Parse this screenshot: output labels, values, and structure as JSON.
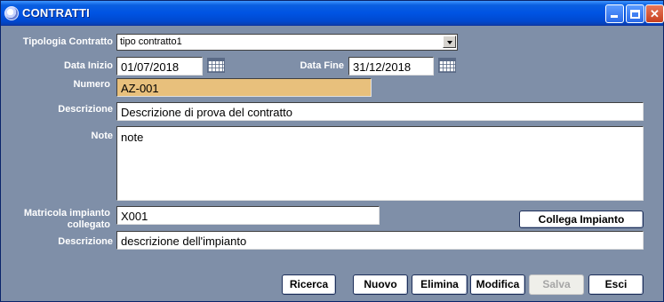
{
  "window": {
    "title": "CONTRATTI"
  },
  "form": {
    "tipologia": {
      "label": "Tipologia Contratto",
      "value": "tipo contratto1"
    },
    "data_inizio": {
      "label": "Data Inizio",
      "value": "01/07/2018"
    },
    "data_fine": {
      "label": "Data Fine",
      "value": "31/12/2018"
    },
    "numero": {
      "label": "Numero",
      "value": "AZ-001"
    },
    "descrizione": {
      "label": "Descrizione",
      "value": "Descrizione di prova del contratto"
    },
    "note": {
      "label": "Note",
      "value": "note"
    },
    "matricola": {
      "label_line1": "Matricola impianto",
      "label_line2": "collegato",
      "value": "X001"
    },
    "collega_button": "Collega Impianto",
    "descrizione_impianto": {
      "label": "Descrizione",
      "value": "descrizione dell'impianto"
    }
  },
  "buttons": {
    "ricerca": "Ricerca",
    "nuovo": "Nuovo",
    "elimina": "Elimina",
    "modifica": "Modifica",
    "salva": "Salva",
    "esci": "Esci"
  }
}
